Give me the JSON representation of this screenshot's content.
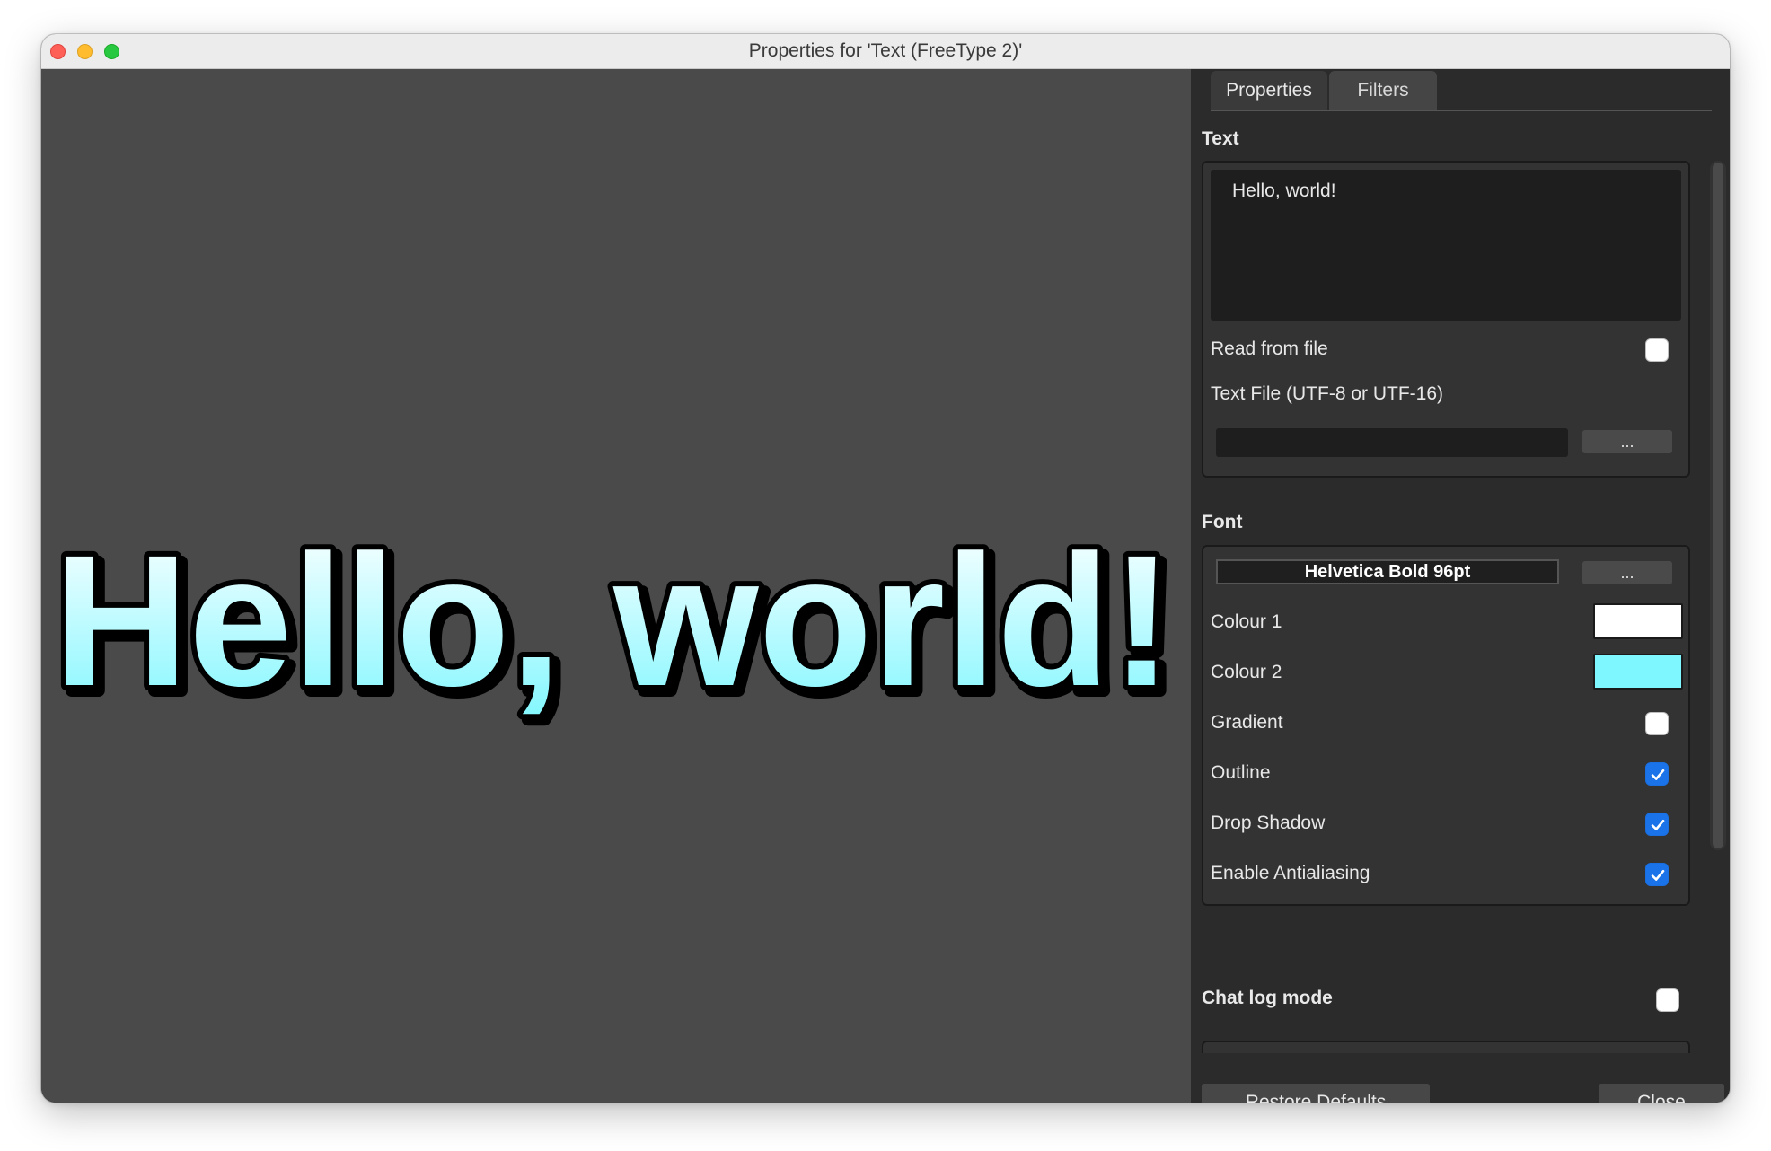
{
  "window": {
    "title": "Properties for 'Text (FreeType 2)'"
  },
  "preview": {
    "text": "Hello, world!",
    "colours": {
      "fill_top": "#ffffff",
      "fill_bottom": "#7ff7ff",
      "outline": "#000000",
      "background": "#4a4a4a"
    }
  },
  "tabs": [
    {
      "label": "Properties",
      "active": true
    },
    {
      "label": "Filters",
      "active": false
    }
  ],
  "sections": {
    "text": {
      "label": "Text",
      "value": "Hello, world!",
      "read_from_file": {
        "label": "Read from file",
        "checked": false
      },
      "text_file": {
        "label": "Text File (UTF-8 or UTF-16)",
        "value": "",
        "browse": "..."
      }
    },
    "font": {
      "label": "Font",
      "font_name": "Helvetica Bold 96pt",
      "font_browse": "...",
      "colour1": {
        "label": "Colour 1",
        "value": "#ffffff"
      },
      "colour2": {
        "label": "Colour 2",
        "value": "#7ff7ff"
      },
      "gradient": {
        "label": "Gradient",
        "checked": false
      },
      "outline": {
        "label": "Outline",
        "checked": true
      },
      "drop_shadow": {
        "label": "Drop Shadow",
        "checked": true
      },
      "antialiasing": {
        "label": "Enable Antialiasing",
        "checked": true
      }
    },
    "chat_log": {
      "label": "Chat log mode",
      "checked": false
    }
  },
  "buttons": {
    "restore_defaults": "Restore Defaults",
    "close": "Close"
  }
}
